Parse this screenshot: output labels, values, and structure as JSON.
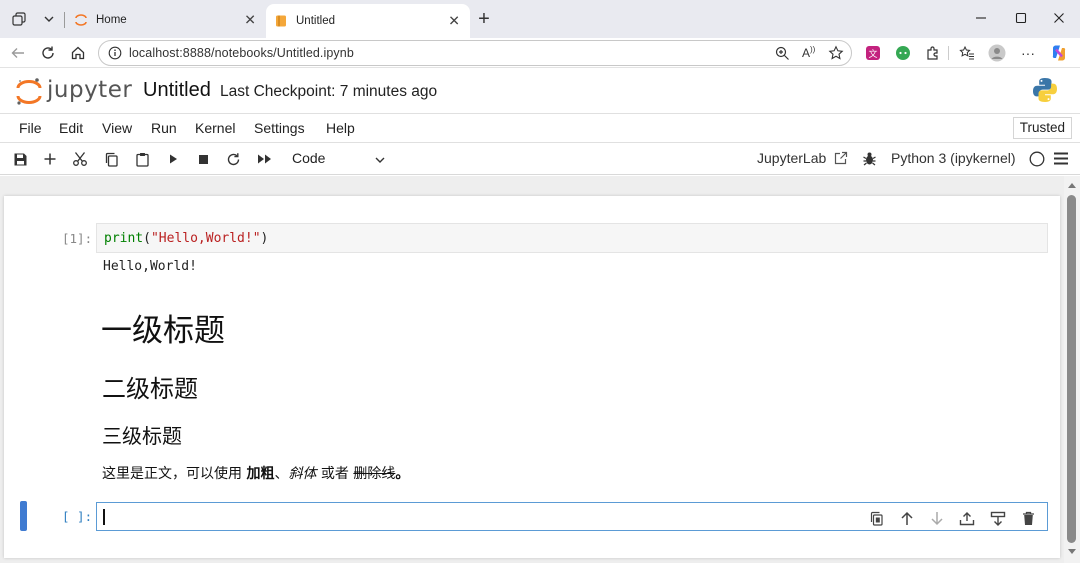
{
  "browser": {
    "tabs": [
      {
        "label": "Home",
        "active": false
      },
      {
        "label": "Untitled",
        "active": true
      }
    ],
    "new_tab_label": "+",
    "url": "localhost:8888/notebooks/Untitled.ipynb"
  },
  "header": {
    "logo_text": "jupyter",
    "notebook_title": "Untitled",
    "checkpoint": "Last Checkpoint: 7 minutes ago"
  },
  "menubar": {
    "items": [
      "File",
      "Edit",
      "View",
      "Run",
      "Kernel",
      "Settings",
      "Help"
    ],
    "trusted": "Trusted"
  },
  "toolbar": {
    "cell_type": "Code",
    "jupyterlab_link": "JupyterLab",
    "kernel": "Python 3 (ipykernel)"
  },
  "cells": [
    {
      "prompt": "[1]:",
      "code": {
        "func": "print",
        "open": "(",
        "string": "\"Hello,World!\"",
        "close": ")"
      },
      "output": "Hello,World!"
    },
    {
      "h1": "一级标题",
      "h2": "二级标题",
      "h3": "三级标题",
      "paragraph": {
        "prefix": "这里是正文，可以使用 ",
        "bold": "加粗",
        "sep1": "、",
        "italic": "斜体",
        "mid": " 或者 ",
        "strike": "删除线",
        "suffix": "。"
      }
    },
    {
      "prompt": "[ ]:",
      "code": ""
    }
  ],
  "colors": {
    "accent": "#3f7bd1",
    "jupyter_orange": "#f37726",
    "code_keyword": "#008000",
    "code_string": "#ba2121"
  }
}
